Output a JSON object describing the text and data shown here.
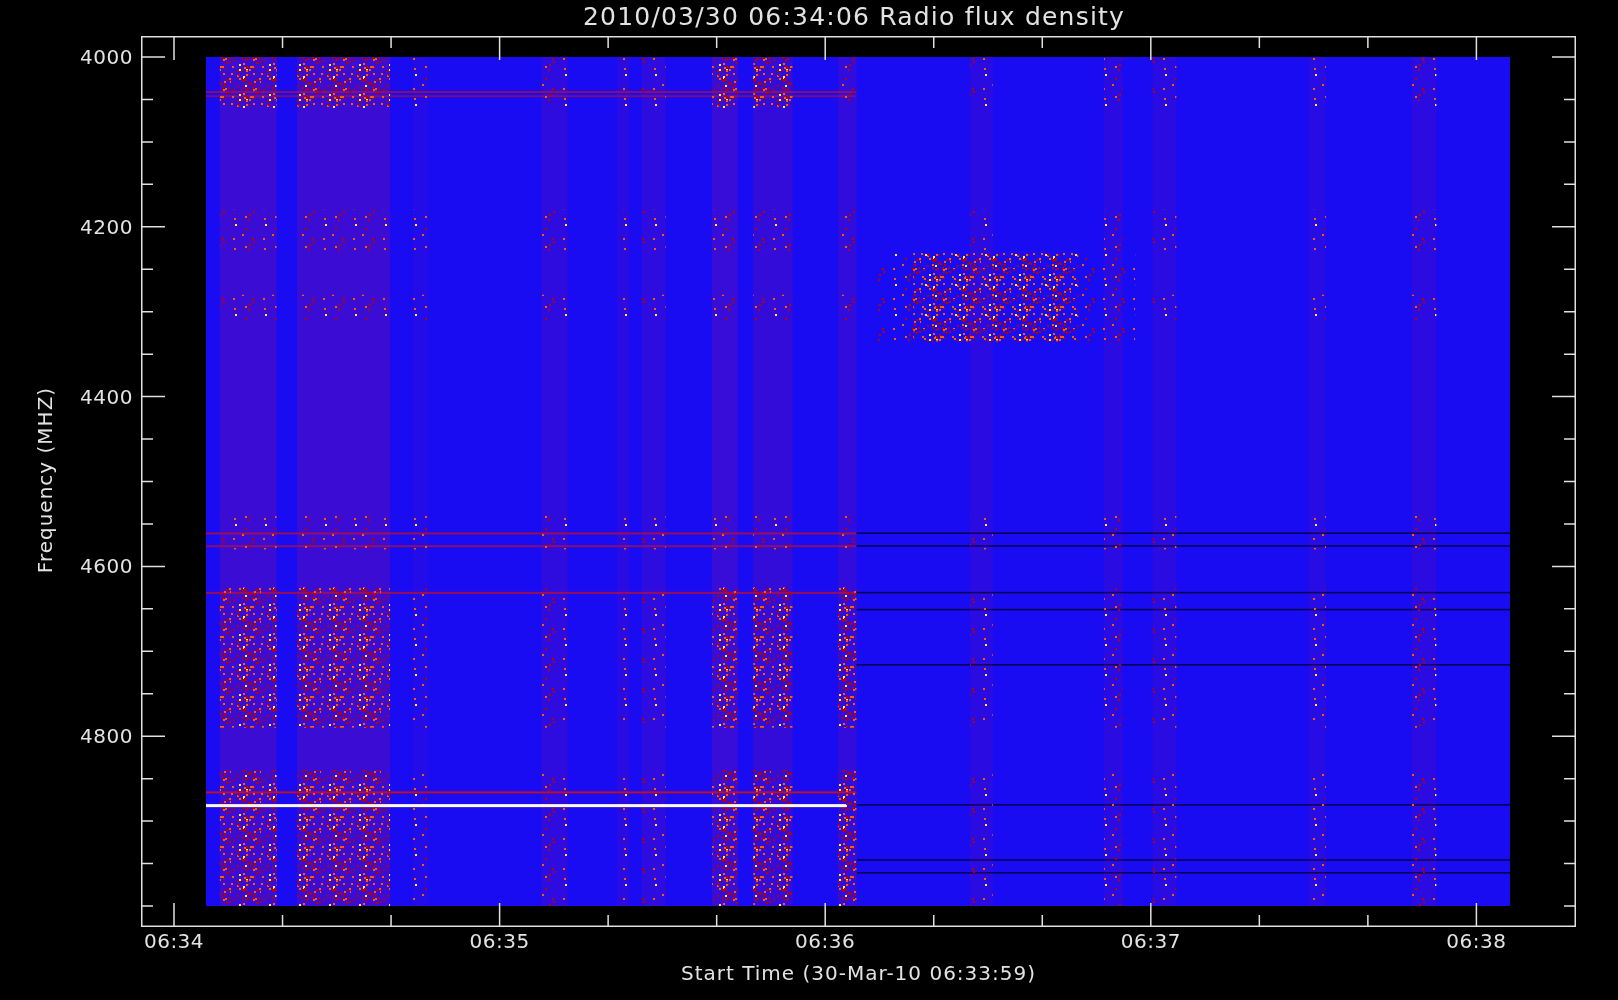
{
  "title": "2010/03/30 06:34:06 Radio flux density",
  "y_axis": {
    "label": "Frequency (MHZ)",
    "ticks": [
      "4000",
      "4200",
      "4400",
      "4600",
      "4800"
    ]
  },
  "x_axis": {
    "label": "Start Time (30-Mar-10 06:33:59)",
    "ticks": [
      "06:34",
      "06:35",
      "06:36",
      "06:37",
      "06:38"
    ]
  }
}
